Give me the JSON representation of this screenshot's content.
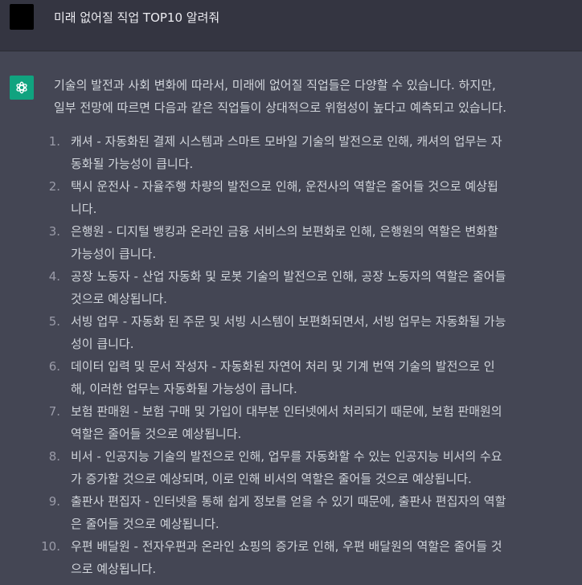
{
  "user_message": {
    "text": "미래 없어질 직업 TOP10 알려줘"
  },
  "assistant_message": {
    "intro_lines": [
      "기술의 발전과 사회 변화에 따라서, 미래에 없어질 직업들은 다양할 수 있습니다. 하지만,",
      "일부 전망에 따르면 다음과 같은 직업들이 상대적으로 위험성이 높다고 예측되고 있습니다."
    ],
    "items": [
      {
        "num": "1.",
        "lines": [
          "캐셔 - 자동화된 결제 시스템과 스마트 모바일 기술의 발전으로 인해, 캐셔의 업무는 자",
          "동화될 가능성이 큽니다."
        ]
      },
      {
        "num": "2.",
        "lines": [
          "택시 운전사 - 자율주행 차량의 발전으로 인해, 운전사의 역할은 줄어들 것으로 예상됩",
          "니다."
        ]
      },
      {
        "num": "3.",
        "lines": [
          "은행원 - 디지털 뱅킹과 온라인 금융 서비스의 보편화로 인해, 은행원의 역할은 변화할",
          "가능성이 큽니다."
        ]
      },
      {
        "num": "4.",
        "lines": [
          "공장 노동자 - 산업 자동화 및 로봇 기술의 발전으로 인해, 공장 노동자의 역할은 줄어들",
          "것으로 예상됩니다."
        ]
      },
      {
        "num": "5.",
        "lines": [
          "서빙 업무 - 자동화 된 주문 및 서빙 시스템이 보편화되면서, 서빙 업무는 자동화될 가능",
          "성이 큽니다."
        ]
      },
      {
        "num": "6.",
        "lines": [
          "데이터 입력 및 문서 작성자 - 자동화된 자연어 처리 및 기계 번역 기술의 발전으로 인",
          "해, 이러한 업무는 자동화될 가능성이 큽니다."
        ]
      },
      {
        "num": "7.",
        "lines": [
          "보험 판매원 - 보험 구매 및 가입이 대부분 인터넷에서 처리되기 때문에, 보험 판매원의",
          "역할은 줄어들 것으로 예상됩니다."
        ]
      },
      {
        "num": "8.",
        "lines": [
          "비서 - 인공지능 기술의 발전으로 인해, 업무를 자동화할 수 있는 인공지능 비서의 수요",
          "가 증가할 것으로 예상되며, 이로 인해 비서의 역할은 줄어들 것으로 예상됩니다."
        ]
      },
      {
        "num": "9.",
        "lines": [
          "출판사 편집자 - 인터넷을 통해 쉽게 정보를 얻을 수 있기 때문에, 출판사 편집자의 역할",
          "은 줄어들 것으로 예상됩니다."
        ]
      },
      {
        "num": "10.",
        "lines": [
          "우편 배달원 - 전자우편과 온라인 쇼핑의 증가로 인해, 우편 배달원의 역할은 줄어들 것",
          "으로 예상됩니다."
        ]
      }
    ]
  },
  "colors": {
    "user_bg": "#343541",
    "assistant_bg": "#444654",
    "bot_avatar": "#10a37f",
    "text": "#d1d5db"
  },
  "icons": {
    "user_avatar": "user-avatar-square",
    "bot_avatar": "openai-logo-icon"
  }
}
